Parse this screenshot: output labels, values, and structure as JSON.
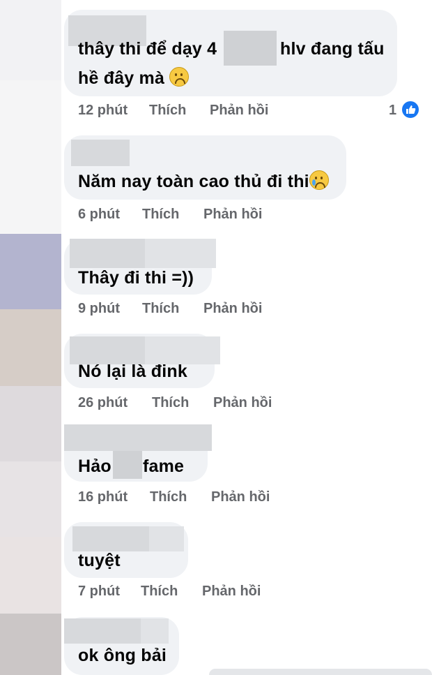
{
  "comments": [
    {
      "text_a": "thây thi để dạy 4",
      "text_b": "hlv đang tấu",
      "text_line2": "hề đây mà",
      "emoji": "sad-face",
      "time": "12 phút",
      "like": "Thích",
      "reply": "Phản hồi",
      "reaction_count": "1"
    },
    {
      "text": "Năm nay toàn cao thủ đi thi",
      "emoji": "crying-face",
      "time": "6 phút",
      "like": "Thích",
      "reply": "Phản hồi"
    },
    {
      "text": "Thây đi thi =))",
      "time": "9 phút",
      "like": "Thích",
      "reply": "Phản hồi"
    },
    {
      "text": "Nó lại là đink",
      "time": "26 phút",
      "like": "Thích",
      "reply": "Phản hồi"
    },
    {
      "text_a": "Hảo",
      "text_b": "fame",
      "time": "16 phút",
      "like": "Thích",
      "reply": "Phản hồi"
    },
    {
      "text": "tuyệt",
      "time": "7 phút",
      "like": "Thích",
      "reply": "Phản hồi"
    },
    {
      "text": "ok ông bải"
    }
  ],
  "colors": {
    "bubble": "#f0f2f5",
    "meta_text": "#65676b",
    "like_blue": "#1877f2",
    "blur": "#d7d9dc"
  }
}
